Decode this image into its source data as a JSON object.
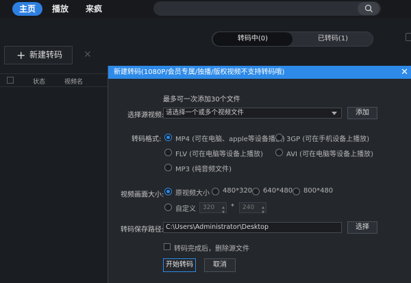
{
  "nav": {
    "tabs": [
      "主页",
      "播放",
      "来疯"
    ],
    "active_index": 0,
    "accent": "#2e7fe0"
  },
  "search": {
    "placeholder": ""
  },
  "convert_tabs": {
    "converting": "转码中(0)",
    "converted": "已转码(1)"
  },
  "left_panel": {
    "new_button": "新建转码",
    "columns": [
      "状态",
      "视频名"
    ]
  },
  "dialog": {
    "title": "新建转码(1080P/会员专属/独播/版权视频不支持转码哦)",
    "hint": "最多可一次添加30个文件",
    "source_label": "选择源视频:",
    "source_placeholder": "请选择一个或多个视频文件",
    "add_button": "添加",
    "format_label": "转码格式:",
    "formats": [
      "MP4 (可在电脑、apple等设备播放)",
      "3GP (可在手机设备上播放)",
      "FLV (可在电脑等设备上播放)",
      "AVI (可在电脑等设备上播放)",
      "MP3 (纯音频文件)"
    ],
    "selected_format": "MP4 (可在电脑、apple等设备播放)",
    "size_label": "视频画面大小:",
    "sizes": [
      "原视频大小",
      "480*320",
      "640*480",
      "800*480"
    ],
    "selected_size": "原视频大小",
    "custom_label": "自定义",
    "custom_width": "320",
    "custom_sep": "*",
    "custom_height": "240",
    "save_label": "转码保存路径:",
    "save_path": "C:\\Users\\Administrator\\Desktop",
    "browse_button": "选择",
    "delete_source_label": "转码完成后，删除源文件",
    "start_button": "开始转码",
    "cancel_button": "取消"
  }
}
